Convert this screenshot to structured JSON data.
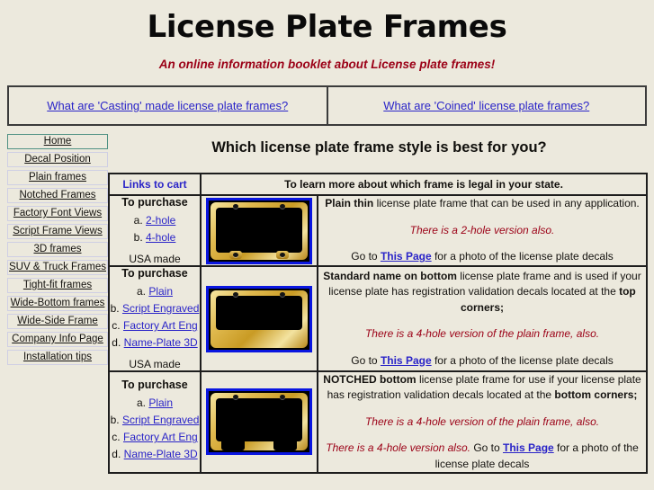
{
  "header": {
    "title": "License Plate Frames",
    "subtitle": "An online information booklet about License plate frames!"
  },
  "topbar": {
    "links": [
      {
        "label": "What are 'Casting' made license plate frames?"
      },
      {
        "label": "What are 'Coined' license plate frames?"
      }
    ]
  },
  "sidebar": {
    "items": [
      {
        "label": "Home",
        "active": true
      },
      {
        "label": "Decal Position",
        "active": false
      },
      {
        "label": "Plain frames",
        "active": false
      },
      {
        "label": "Notched Frames",
        "active": false
      },
      {
        "label": "Factory Font Views",
        "active": false
      },
      {
        "label": "Script Frame Views",
        "active": false
      },
      {
        "label": "3D frames",
        "active": false
      },
      {
        "label": "SUV & Truck Frames",
        "active": false
      },
      {
        "label": "Tight-fit frames",
        "active": false
      },
      {
        "label": "Wide-Bottom frames",
        "active": false
      },
      {
        "label": "Wide-Side Frame",
        "active": false
      },
      {
        "label": "Company Info Page",
        "active": false
      },
      {
        "label": "Installation tips",
        "active": false
      }
    ]
  },
  "main": {
    "heading": "Which license plate frame style is best for you?",
    "table": {
      "header_cart": "Links to cart",
      "header_desc": "To learn more about which frame is legal in your state.",
      "rows": [
        {
          "cart": {
            "title": "To purchase",
            "links": [
              {
                "prefix": "a.",
                "label": "2-hole"
              },
              {
                "prefix": "b.",
                "label": "4-hole"
              }
            ],
            "footer": "USA made"
          },
          "image_name": "plain-thin-gold-license-plate-frame",
          "desc": {
            "bold": "Plain thin",
            "rest": " license plate frame that can be used in any application.",
            "note": "There is a 2-hole version also.",
            "goto_prefix": "Go to ",
            "goto_link": "This Page",
            "goto_suffix": " for a photo of the license plate decals"
          }
        },
        {
          "cart": {
            "title": "To purchase",
            "links": [
              {
                "prefix": "a.",
                "label": "Plain"
              },
              {
                "prefix": "b.",
                "label": "Script Engraved"
              },
              {
                "prefix": "c.",
                "label": "Factory Art Eng"
              },
              {
                "prefix": "d.",
                "label": "Name-Plate 3D"
              }
            ],
            "footer": "USA made"
          },
          "image_name": "standard-name-on-bottom-gold-license-plate-frame",
          "desc": {
            "bold": "Standard name on bottom",
            "rest": " license plate frame and is used if your license plate has registration validation decals located at the ",
            "rest_bold": "top corners;",
            "note": "There is a 4-hole version of the plain frame, also.",
            "goto_prefix": "Go to ",
            "goto_link": "This Page",
            "goto_suffix": " for a photo of the license plate decals"
          }
        },
        {
          "cart": {
            "title": "To purchase",
            "links": [
              {
                "prefix": "a.",
                "label": "Plain"
              },
              {
                "prefix": "b.",
                "label": "Script Engraved"
              },
              {
                "prefix": "c.",
                "label": "Factory Art Eng"
              },
              {
                "prefix": "d.",
                "label": "Name-Plate 3D"
              }
            ],
            "footer": ""
          },
          "image_name": "notched-bottom-gold-license-plate-frame",
          "desc": {
            "bold": "NOTCHED bottom",
            "rest": " license plate frame for use if your license plate has registration validation decals located at the ",
            "rest_bold": "bottom corners;",
            "note": "There is a 4-hole version of the plain frame, also.",
            "cut_note": "There is a 4-hole version also.",
            "goto_prefix": "  Go to ",
            "goto_link": "This Page",
            "goto_suffix": " for a photo of the license plate decals"
          }
        }
      ]
    }
  },
  "colors": {
    "page_background": "#ece9dd",
    "link": "#2a24c8",
    "accent_red": "#9b0016",
    "text": "#14120f",
    "border": "#1d1d1d",
    "active_nav_border": "#4f9183",
    "nav_border": "#cfcfe4",
    "image_border": "#0a16e0",
    "gold": "#e0b94e"
  }
}
